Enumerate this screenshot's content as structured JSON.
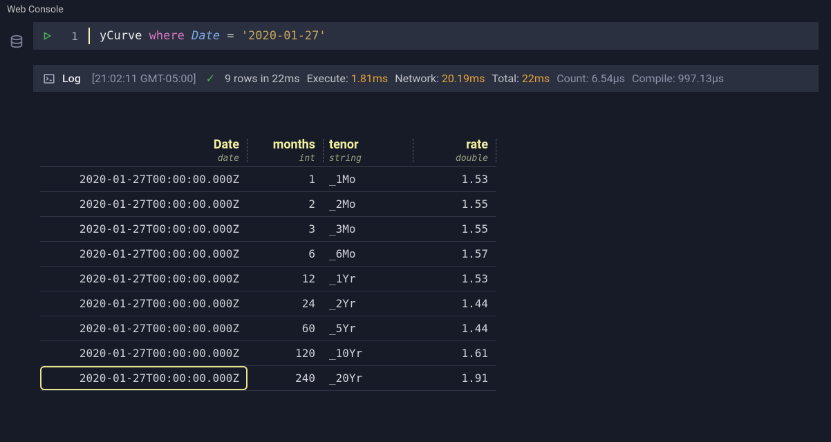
{
  "header": {
    "title": "Web Console"
  },
  "query": {
    "line_number": "1",
    "tokens": {
      "ident": "yCurve",
      "keyword": "where",
      "column": "Date",
      "op": "=",
      "string": "'2020-01-27'"
    }
  },
  "log": {
    "label": "Log",
    "timestamp": "[21:02:11 GMT-05:00]",
    "rows_msg": "9 rows in 22ms",
    "execute_label": "Execute:",
    "execute_val": "1.81ms",
    "network_label": "Network:",
    "network_val": "20.19ms",
    "total_label": "Total:",
    "total_val": "22ms",
    "count_label": "Count:",
    "count_val": "6.54µs",
    "compile_label": "Compile:",
    "compile_val": "997.13µs"
  },
  "table": {
    "columns": [
      {
        "name": "Date",
        "type": "date",
        "align": "right"
      },
      {
        "name": "months",
        "type": "int",
        "align": "right"
      },
      {
        "name": "tenor",
        "type": "string",
        "align": "left"
      },
      {
        "name": "rate",
        "type": "double",
        "align": "right"
      }
    ],
    "rows": [
      {
        "Date": "2020-01-27T00:00:00.000Z",
        "months": "1",
        "tenor": "_1Mo",
        "rate": "1.53"
      },
      {
        "Date": "2020-01-27T00:00:00.000Z",
        "months": "2",
        "tenor": "_2Mo",
        "rate": "1.55"
      },
      {
        "Date": "2020-01-27T00:00:00.000Z",
        "months": "3",
        "tenor": "_3Mo",
        "rate": "1.55"
      },
      {
        "Date": "2020-01-27T00:00:00.000Z",
        "months": "6",
        "tenor": "_6Mo",
        "rate": "1.57"
      },
      {
        "Date": "2020-01-27T00:00:00.000Z",
        "months": "12",
        "tenor": "_1Yr",
        "rate": "1.53"
      },
      {
        "Date": "2020-01-27T00:00:00.000Z",
        "months": "24",
        "tenor": "_2Yr",
        "rate": "1.44"
      },
      {
        "Date": "2020-01-27T00:00:00.000Z",
        "months": "60",
        "tenor": "_5Yr",
        "rate": "1.44"
      },
      {
        "Date": "2020-01-27T00:00:00.000Z",
        "months": "120",
        "tenor": "_10Yr",
        "rate": "1.61"
      },
      {
        "Date": "2020-01-27T00:00:00.000Z",
        "months": "240",
        "tenor": "_20Yr",
        "rate": "1.91"
      }
    ],
    "selected_index": 8
  }
}
